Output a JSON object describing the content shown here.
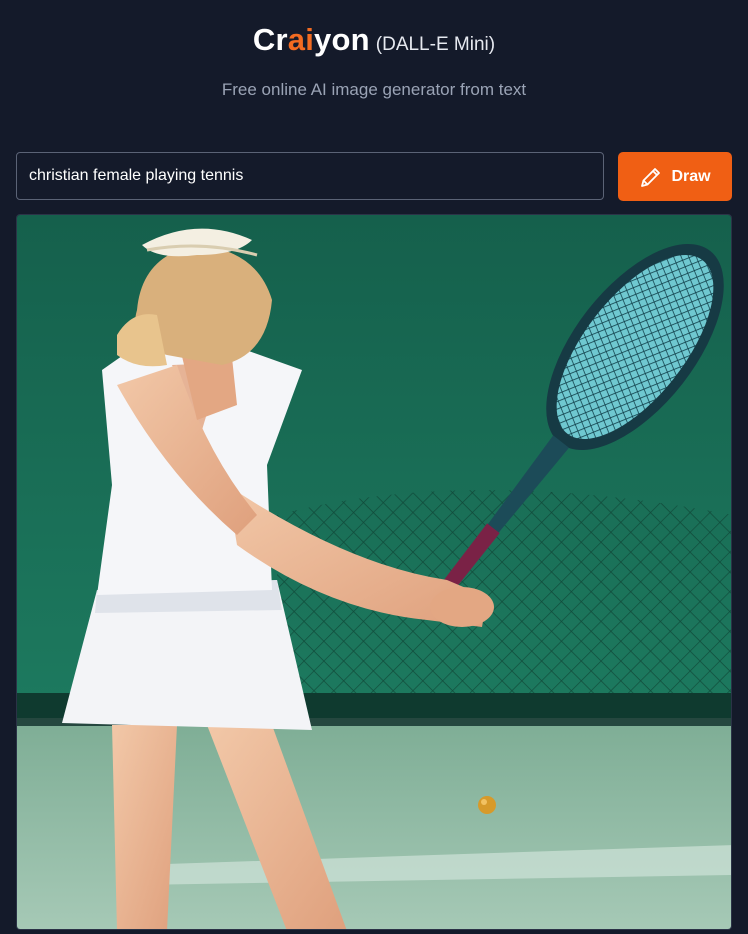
{
  "header": {
    "logo": {
      "part1": "Cr",
      "part2": "ai",
      "part3": "yon",
      "subtitle": "(DALL-E Mini)"
    },
    "tagline": "Free online AI image generator from text"
  },
  "prompt": {
    "value": "christian female playing tennis",
    "placeholder": ""
  },
  "draw_button": {
    "label": "Draw",
    "icon": "pencil-icon"
  },
  "colors": {
    "background": "#141a2a",
    "accent": "#f05f14",
    "text_muted": "#9aa3b5"
  },
  "result_image": {
    "subject": "woman in white tennis dress swinging a racket on a green court"
  }
}
